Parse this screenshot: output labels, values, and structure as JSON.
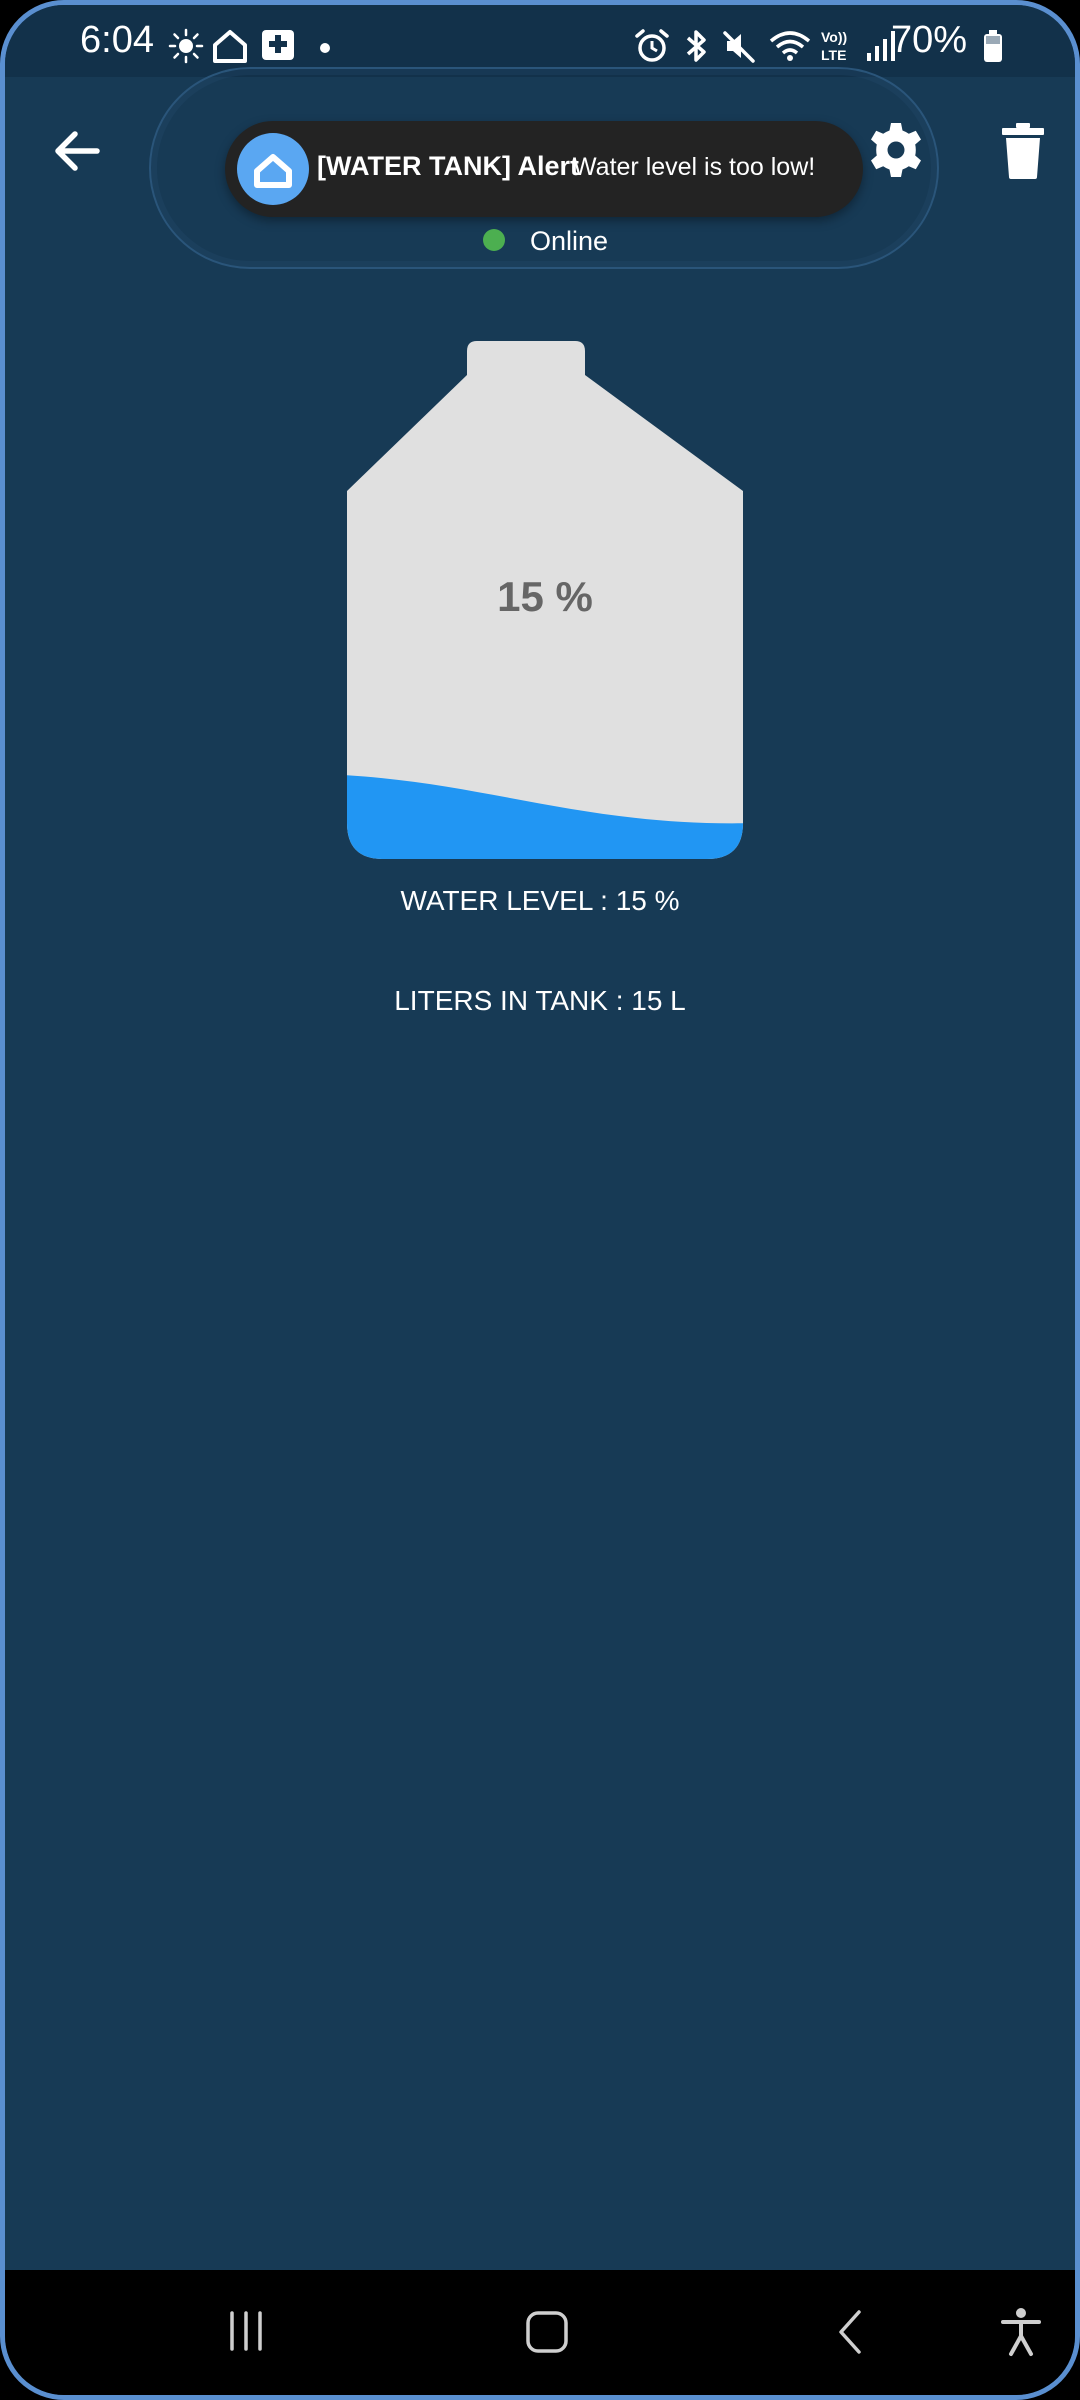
{
  "status_bar": {
    "time": "6:04",
    "battery": "70%",
    "left_icons": [
      "brightness-icon",
      "home-icon",
      "medical-icon",
      "dot-icon"
    ],
    "right_icons": [
      "alarm-icon",
      "bluetooth-icon",
      "mute-icon",
      "wifi-icon",
      "volte-icon",
      "signal-icon",
      "battery-icon"
    ]
  },
  "app_bar": {
    "back_icon": "arrow-left-icon",
    "settings_icon": "gear-icon",
    "delete_icon": "trash-icon"
  },
  "alert": {
    "title": "[WATER TANK] Alert",
    "message": "Water level is too low!",
    "icon": "home-icon"
  },
  "device_status": {
    "label": "Online",
    "color": "#4caf50"
  },
  "tank": {
    "percent_text": "15 %",
    "fill_fraction": 0.15,
    "water_color": "#2196f3",
    "body_color": "#e0e0e0"
  },
  "readings": {
    "water_level": "WATER LEVEL  : 15 %",
    "liters": "LITERS IN TANK  : 15 L"
  },
  "nav_bar": {
    "icons": [
      "recents-icon",
      "home-icon",
      "back-icon",
      "accessibility-icon"
    ]
  },
  "colors": {
    "background": "#173a55",
    "status_bar": "#12314a",
    "accent": "#2196f3"
  }
}
